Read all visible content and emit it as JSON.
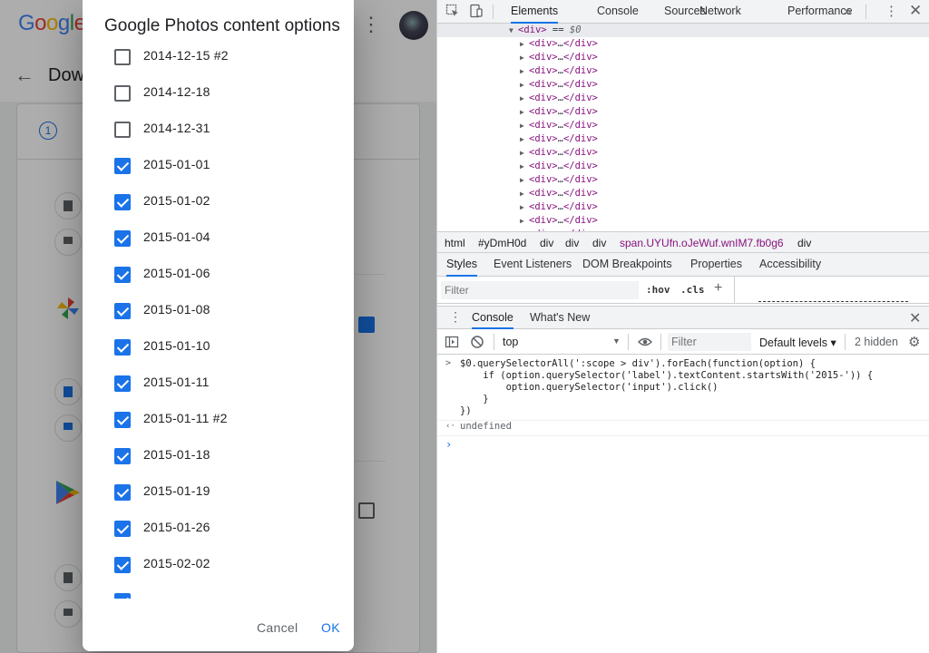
{
  "background_page": {
    "logo_text": "Google",
    "logo_colors": [
      "#4285f4",
      "#ea4335",
      "#fbbc05",
      "#4285f4",
      "#34a853",
      "#ea4335"
    ],
    "page_title": "Dow",
    "step_number": "1"
  },
  "dialog": {
    "title": "Google Photos content options",
    "options": [
      {
        "label": "2014-12-15 #2",
        "checked": false
      },
      {
        "label": "2014-12-18",
        "checked": false
      },
      {
        "label": "2014-12-31",
        "checked": false
      },
      {
        "label": "2015-01-01",
        "checked": true
      },
      {
        "label": "2015-01-02",
        "checked": true
      },
      {
        "label": "2015-01-04",
        "checked": true
      },
      {
        "label": "2015-01-06",
        "checked": true
      },
      {
        "label": "2015-01-08",
        "checked": true
      },
      {
        "label": "2015-01-10",
        "checked": true
      },
      {
        "label": "2015-01-11",
        "checked": true
      },
      {
        "label": "2015-01-11 #2",
        "checked": true
      },
      {
        "label": "2015-01-18",
        "checked": true
      },
      {
        "label": "2015-01-19",
        "checked": true
      },
      {
        "label": "2015-01-26",
        "checked": true
      },
      {
        "label": "2015-02-02",
        "checked": true
      },
      {
        "label": "",
        "checked": true
      }
    ],
    "cancel_label": "Cancel",
    "ok_label": "OK",
    "accent": "#1a73e8"
  },
  "devtools": {
    "tabs": [
      "Elements",
      "Console",
      "Sources",
      "Network",
      "Performance"
    ],
    "active_tab": "Elements",
    "more_tabs": "»",
    "selected_node": {
      "open": "<div>",
      "suffix": " == ",
      "var": "$0"
    },
    "collapsed_row": {
      "open": "<div>",
      "ellipsis": "…",
      "close": "</div>"
    },
    "collapsed_row_count": 15,
    "breadcrumbs": [
      "html",
      "#yDmH0d",
      "div",
      "div",
      "div",
      "span.UYUfn.oJeWuf.wnIM7.fb0g6",
      "div"
    ],
    "sub_tabs": [
      "Styles",
      "Event Listeners",
      "DOM Breakpoints",
      "Properties",
      "Accessibility"
    ],
    "active_sub_tab": "Styles",
    "styles_filter_placeholder": "Filter",
    "hov_label": ":hov",
    "cls_label": ".cls",
    "add_rule_label": "+",
    "drawer_tabs": [
      "Console",
      "What's New"
    ],
    "active_drawer_tab": "Console",
    "console_context": "top",
    "console_filter_placeholder": "Filter",
    "log_levels": "Default levels ▾",
    "hidden_count": "2 hidden",
    "console_lines": [
      "$0.querySelectorAll(':scope > div').forEach(function(option) {",
      "    if (option.querySelector('label').textContent.startsWith('2015-')) {",
      "        option.querySelector('input').click()",
      "    }",
      "})"
    ],
    "console_result": "undefined",
    "input_prompt": "›",
    "prompt_symbol": ">",
    "result_symbol": "‹·"
  }
}
